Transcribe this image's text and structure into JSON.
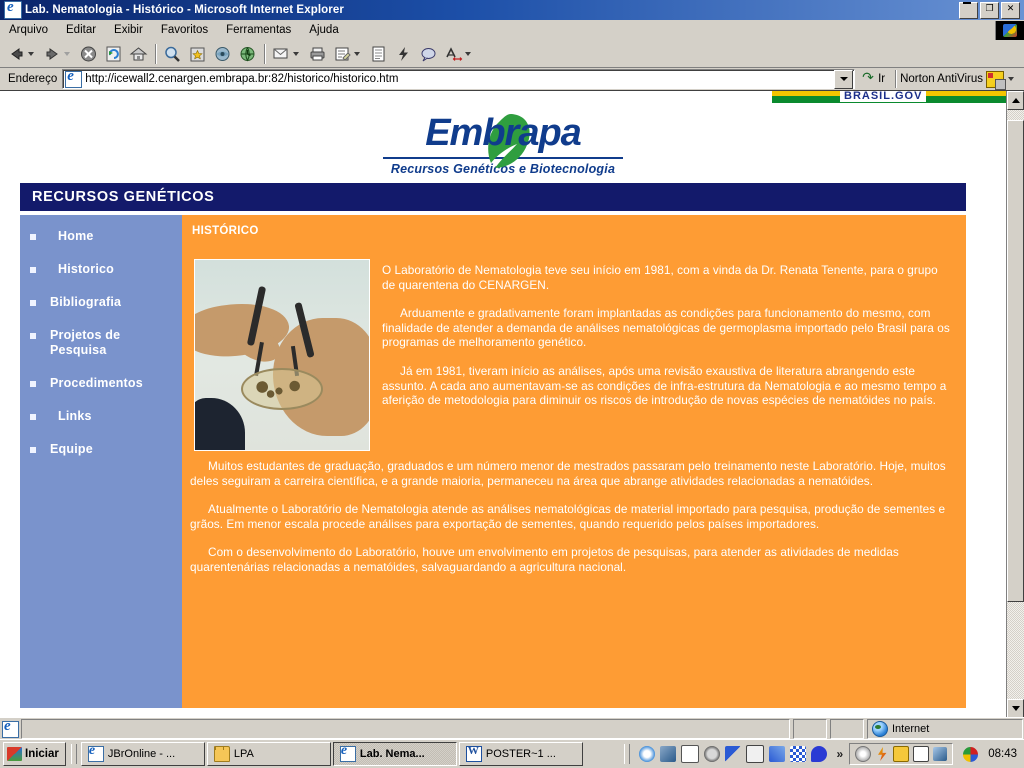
{
  "window": {
    "title": "Lab. Nematologia - Histórico - Microsoft Internet Explorer",
    "minimize_label": "_",
    "maximize_label": "❐",
    "close_label": "✕"
  },
  "menu": {
    "items": [
      "Arquivo",
      "Editar",
      "Exibir",
      "Favoritos",
      "Ferramentas",
      "Ajuda"
    ]
  },
  "toolbar": {
    "buttons": [
      "back-button",
      "forward-button",
      "stop-button",
      "refresh-button",
      "home-button",
      "search-button",
      "favorites-button",
      "media-button",
      "history-button",
      "mail-button",
      "print-button",
      "edit-button",
      "discuss-button",
      "messenger-button",
      "research-button",
      "translate-button"
    ]
  },
  "address": {
    "label": "Endereço",
    "url": "http://icewall2.cenargen.embrapa.br:82/historico/historico.htm",
    "go_label": "Ir",
    "norton_label": "Norton AntiVirus"
  },
  "page": {
    "gov_banner": "BRASIL.GOV",
    "logo": {
      "word": "Embrapa",
      "subtitle": "Recursos Genéticos e Biotecnologia"
    },
    "section_title": "RECURSOS GENÉTICOS",
    "sidebar": {
      "items": [
        {
          "label": "Home"
        },
        {
          "label": "Historico"
        },
        {
          "label": "Bibliografia"
        },
        {
          "label": "Projetos de\nPesquisa"
        },
        {
          "label": "Procedimentos"
        },
        {
          "label": "Links"
        },
        {
          "label": "Equipe"
        }
      ]
    },
    "content": {
      "title": "HISTÓRICO",
      "photo_caption": "lab-hands-petri-dish-photo",
      "paragraphs": [
        "O Laboratório de Nematologia teve seu início em 1981, com a vinda da Dr. Renata Tenente, para o grupo de quarentena do CENARGEN.",
        "Arduamente e gradativamente foram implantadas as condições para funcionamento do mesmo, com finalidade de atender a demanda de análises nematológicas de germoplasma importado pelo Brasil para os programas de melhoramento genético.",
        "Já em 1981, tiveram início as análises, após uma revisão exaustiva de literatura abrangendo este assunto. A cada ano aumentavam-se as condições de infra-estrutura da Nematologia e ao mesmo tempo a aferição de metodologia para diminuir os riscos de introdução de novas espécies de nematóides no país.",
        "Muitos estudantes de graduação, graduados e um número menor de mestrados passaram pelo treinamento neste Laboratório. Hoje, muitos deles seguiram a carreira científica, e a grande maioria, permaneceu na área que abrange atividades relacionadas a nematóides.",
        "Atualmente o Laboratório de Nematologia atende as análises nematológicas de material importado para pesquisa, produção de sementes e grãos. Em menor escala procede análises para exportação de sementes, quando requerido pelos países importadores.",
        "Com o desenvolvimento do Laboratório, houve um envolvimento em projetos de pesquisas, para atender as atividades de medidas quarentenárias relacionadas a nematóides, salvaguardando a agricultura nacional."
      ]
    },
    "colors": {
      "content_orange": "#fe9c34",
      "sidebar_blue": "#7a93cc",
      "section_navy": "#131a6b",
      "logo_blue": "#103c8c",
      "leaf_green": "#2f9e3f",
      "gov_yellow": "#f2c500",
      "gov_green": "#0a8a2e"
    }
  },
  "statusbar": {
    "zone": "Internet"
  },
  "taskbar": {
    "start_label": "Iniciar",
    "tasks": [
      {
        "label": "JBrOnline - ...",
        "icon": "ie-icon",
        "active": false
      },
      {
        "label": "LPA",
        "icon": "folder-icon",
        "active": false
      },
      {
        "label": "Lab. Nema...",
        "icon": "ie-icon",
        "active": true
      },
      {
        "label": "POSTER~1 ...",
        "icon": "word-icon",
        "active": false
      }
    ],
    "tray_icons": [
      "ie-icon",
      "outlook-icon",
      "notepad-icon",
      "norton-icon",
      "cursor-icon",
      "mail-icon",
      "tag-icon",
      "grid-icon",
      "speech-icon"
    ],
    "overflow_label": "»",
    "status_icons": [
      "disc-icon",
      "power-icon",
      "norton-icon",
      "calendar-icon",
      "network-icon",
      "volume-icon"
    ],
    "clock": "08:43"
  }
}
